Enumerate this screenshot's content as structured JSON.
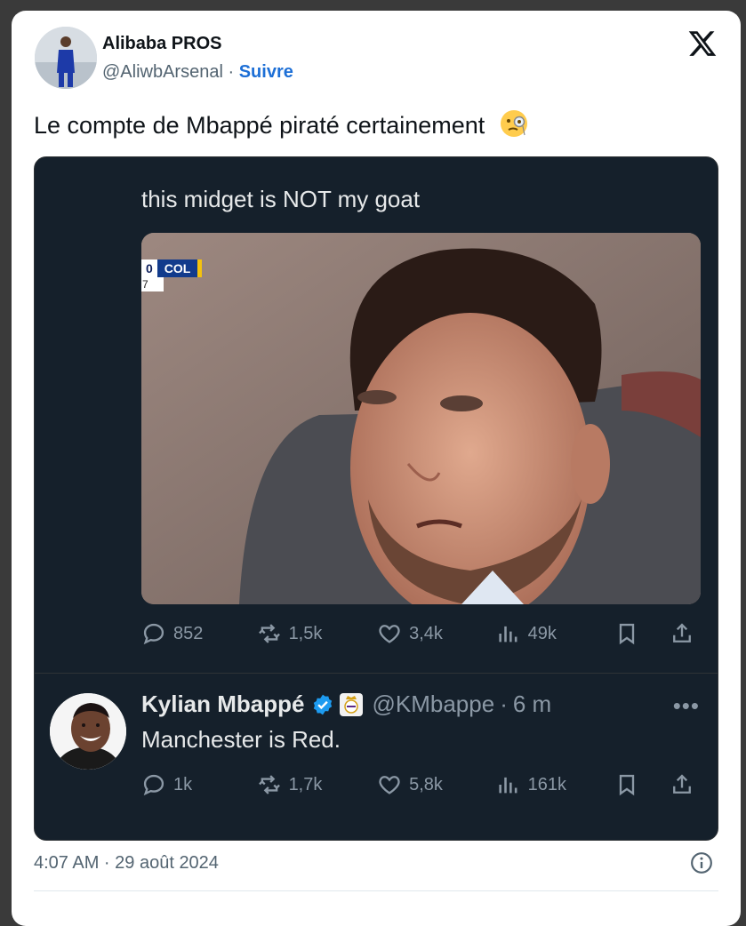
{
  "author": {
    "name": "Alibaba PROS",
    "handle": "@AliwbArsenal",
    "separator": "·",
    "follow_label": "Suivre"
  },
  "tweet": {
    "text": "Le compte de Mbappé piraté certainement",
    "emoji": "face-with-monocle-emoji",
    "timestamp": "4:07 AM · 29 août 2024"
  },
  "quoted_post": {
    "text": "this midget is NOT my goat",
    "scorebug": {
      "score": "0",
      "team": "COL",
      "row2": "7"
    },
    "metrics": {
      "replies": "852",
      "reposts": "1,5k",
      "likes": "3,4k",
      "views": "49k"
    }
  },
  "reply": {
    "name": "Kylian Mbappé",
    "handle": "@KMbappe",
    "separator": "·",
    "time": "6 m",
    "text": "Manchester is Red.",
    "more": "•••",
    "metrics": {
      "replies": "1k",
      "reposts": "1,7k",
      "likes": "5,8k",
      "views": "161k"
    }
  },
  "colors": {
    "accent": "#1d6fd6",
    "dark_bg": "#15202b",
    "muted": "#8b98a5",
    "verified": "#1d9bf0"
  },
  "icons": [
    "x-logo-icon",
    "reply-icon",
    "repost-icon",
    "like-icon",
    "views-icon",
    "bookmark-icon",
    "share-icon",
    "verified-badge-icon",
    "real-madrid-crest-icon",
    "info-icon"
  ]
}
